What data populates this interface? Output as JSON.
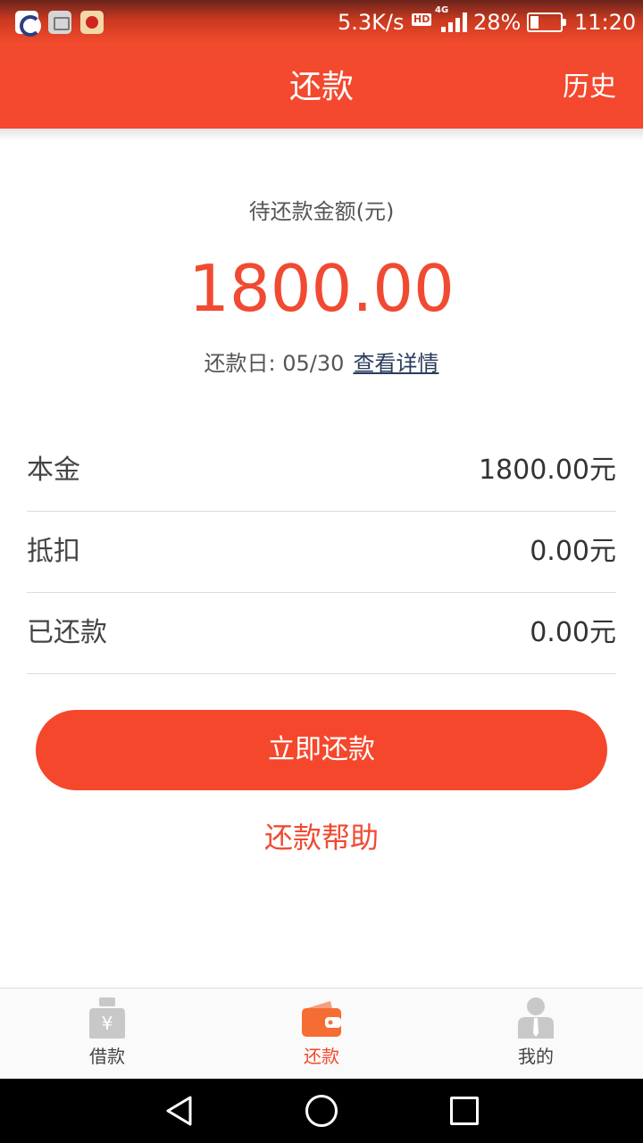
{
  "status_bar": {
    "speed": "5.3K/s",
    "hd_label": "HD",
    "network": "4G",
    "battery_percent": "28%",
    "battery_level": 0.28,
    "time": "11:20"
  },
  "header": {
    "title": "还款",
    "history_label": "历史"
  },
  "summary": {
    "amount_label": "待还款金额(元)",
    "amount": "1800.00",
    "due_label": "还款日: 05/30",
    "details_link": "查看详情"
  },
  "details": [
    {
      "label": "本金",
      "value": "1800.00元"
    },
    {
      "label": "抵扣",
      "value": "0.00元"
    },
    {
      "label": "已还款",
      "value": "0.00元"
    }
  ],
  "actions": {
    "pay_now": "立即还款",
    "help": "还款帮助"
  },
  "tabbar": {
    "items": [
      {
        "label": "借款",
        "icon": "money-bag-icon",
        "active": false
      },
      {
        "label": "还款",
        "icon": "wallet-icon",
        "active": true
      },
      {
        "label": "我的",
        "icon": "profile-icon",
        "active": false
      }
    ]
  },
  "colors": {
    "brand": "#f5472c",
    "accent_text": "#f14a32",
    "inactive_icon": "#c8c8c8"
  }
}
